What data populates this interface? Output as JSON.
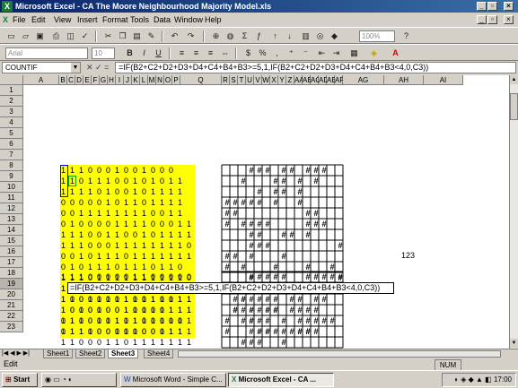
{
  "title": "Microsoft Excel - CA The Moore Neighbourhood Majority Model.xls",
  "menu": [
    "File",
    "Edit",
    "View",
    "Insert",
    "Format",
    "Tools",
    "Data",
    "Window",
    "Help"
  ],
  "toolbar": {
    "zoom": "100%",
    "font": "Arial",
    "size": "10"
  },
  "namebox": "COUNTIF",
  "fx_label": "= ",
  "formula": "=IF(B2+C2+D2+D3+D4+C4+B4+B3>=5,1,IF(B2+C2+D2+D3+D4+C4+B4+B3<4,0,C3))",
  "columns": [
    "A",
    "B",
    "C",
    "D",
    "E",
    "F",
    "G",
    "H",
    "I",
    "J",
    "K",
    "L",
    "M",
    "N",
    "O",
    "P",
    "Q",
    "R",
    "S",
    "T",
    "U",
    "V",
    "W",
    "X",
    "Y",
    "Z",
    "AA",
    "AB",
    "AC",
    "AD",
    "AE",
    "AF",
    "AG",
    "AH",
    "AI"
  ],
  "rows": [
    "1",
    "2",
    "3",
    "4",
    "5",
    "6",
    "7",
    "8",
    "9",
    "10",
    "11",
    "12",
    "13",
    "14",
    "15",
    "16",
    "17",
    "18",
    "19",
    "20",
    "21",
    "22",
    "23"
  ],
  "grid_top": [
    "1 1 1 0 0 0 1 0 0 1 0 0 0",
    "1 1 0 1 1 1 0 0 1 0 1 0 1 1",
    "1 1 1 1 0 1 0 0 1 0 1 1 1 1",
    "0 0 0 0 0 1 0 1 1 0 1 1 1 1",
    "0 0 1 1 1 1 1 1 1 1 0 0 1 1",
    "0 1 0 0 0 0 1 1 1 1 0 0 0 1 1",
    "1 1 1 0 0 1 1 0 0 1 0 1 1 1 1",
    "1 1 1 0 0 0 1 1 1 1 1 1 1 1 0",
    "0 0 1 0 1 1 1 0 1 1 1 1 1 1 1",
    "0 1 0 1 1 1 0 1 1 1 0 1 1 0",
    "1 1 1 0 1 1 1 1 1 1 1 1 1 1 0",
    "1 0 1 1 1 0 1 1 1 1 0 1 0 1",
    "1 1 0 1 1 1 1 1 1 0 1 0 0 1 1",
    "1 0 1 0 1 0 0 1 1 1 1 0 1 1 1",
    "0 1 1 0 0 0 1 1 1 1 0 0 0 0",
    "0 1 1 0 0 0 0 1 1 0 0 0 1 1"
  ],
  "row18": "1 1 1 0 0 0 0 0 1 1 0 0 0 0 0",
  "row19_prefix": "1",
  "row19_formula": "=IF(B2+C2+D2+D3+D4+C4+B4+B3>=5,1,IF(B2+C2+D2+D3+D4+C4+B4+B3<4,0,C3))",
  "grid_bottom": [
    "1 0 0 0 0 0 0 1 0 1 1 1 1 1 1",
    "1 0 0 0 0 0 0 1 0 0 0 1 1 1 1",
    "1 1 0 0 1 1 1 0 1 0 1 1 1 1 1",
    "1 1 1 1 0 0 1 0 0 0 0 1 1 1 1",
    "1 1 0 0 0 1 1 0 1 1 1 1 1 1 1"
  ],
  "cell_ag16": "123",
  "hash_label": "#",
  "sheets": [
    "Sheet1",
    "Sheet2",
    "Sheet3",
    "Sheet4"
  ],
  "active_sheet": "Sheet3",
  "status_left": "Edit",
  "status_right": "NUM",
  "taskbar": {
    "start": "Start",
    "word": "Microsoft Word - Simple C...",
    "excel": "Microsoft Excel - CA ...",
    "time": "17:00"
  }
}
